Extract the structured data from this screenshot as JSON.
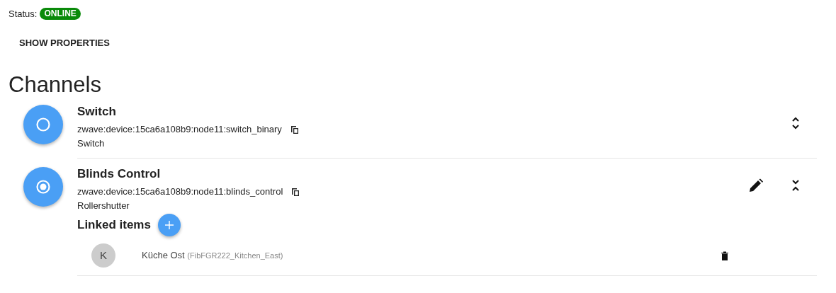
{
  "status": {
    "label": "Status:",
    "badge": "ONLINE",
    "online": true
  },
  "show_properties": "SHOW PROPERTIES",
  "heading": "Channels",
  "channels": [
    {
      "kind": "switch",
      "name": "Switch",
      "uid": "zwave:device:15ca6a108b9:node11:switch_binary",
      "type": "Switch",
      "expanded": false
    },
    {
      "kind": "rollershutter",
      "name": "Blinds Control",
      "uid": "zwave:device:15ca6a108b9:node11:blinds_control",
      "type": "Rollershutter",
      "expanded": true,
      "linked_title": "Linked items",
      "linked_items": [
        {
          "initial": "K",
          "label": "Küche Ost",
          "name": "(FibFGR222_Kitchen_East)"
        }
      ]
    }
  ]
}
